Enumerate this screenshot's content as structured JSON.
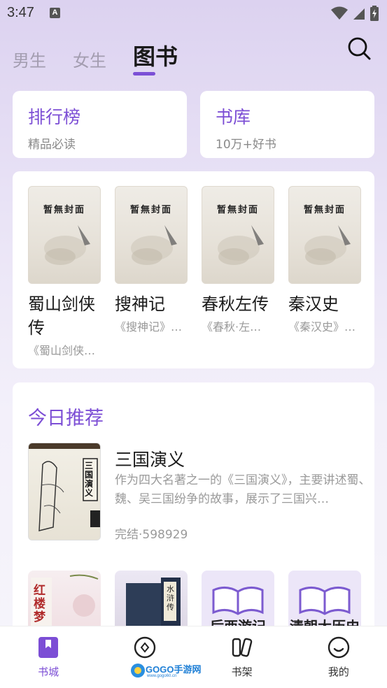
{
  "status_bar": {
    "time": "3:47",
    "notif_letter": "A"
  },
  "top_tabs": [
    {
      "label": "男生",
      "active": false
    },
    {
      "label": "女生",
      "active": false
    },
    {
      "label": "图书",
      "active": true
    }
  ],
  "quick_cards": [
    {
      "title": "排行榜",
      "subtitle": "精品必读"
    },
    {
      "title": "书库",
      "subtitle": "10万+好书"
    }
  ],
  "cover_placeholder": "暂無封面",
  "featured_books": [
    {
      "title": "蜀山剑侠传",
      "desc": "《蜀山剑侠…"
    },
    {
      "title": "搜神记",
      "desc": "《搜神记》…"
    },
    {
      "title": "春秋左传",
      "desc": "《春秋·左…"
    },
    {
      "title": "秦汉史",
      "desc": "《秦汉史》…"
    }
  ],
  "recommend": {
    "section_title": "今日推荐",
    "cover_text": "三国演义",
    "title": "三国演义",
    "description": "作为四大名著之一的《三国演义》，主要讲述蜀、魏、吴三国纷争的故事，展示了三国兴…",
    "meta": "完结·598929"
  },
  "mini_books": [
    {
      "label": "红楼梦",
      "style": "red"
    },
    {
      "label": "水浒传",
      "style": "blue"
    },
    {
      "label": "后西游记",
      "style": "book"
    },
    {
      "label": "清朝大历史",
      "style": "book"
    }
  ],
  "bottom_nav": [
    {
      "label": "书城",
      "icon": "bookmark-icon",
      "active": true
    },
    {
      "label": "",
      "icon": "compass-icon",
      "active": false
    },
    {
      "label": "书架",
      "icon": "bookshelf-icon",
      "active": false
    },
    {
      "label": "我的",
      "icon": "smile-icon",
      "active": false
    }
  ],
  "watermark": {
    "text": "GOGO手游网",
    "url": "www.gogo60.cn"
  },
  "colors": {
    "accent": "#7c4ed5",
    "tab_inactive": "#a39db0",
    "muted": "#999999"
  }
}
